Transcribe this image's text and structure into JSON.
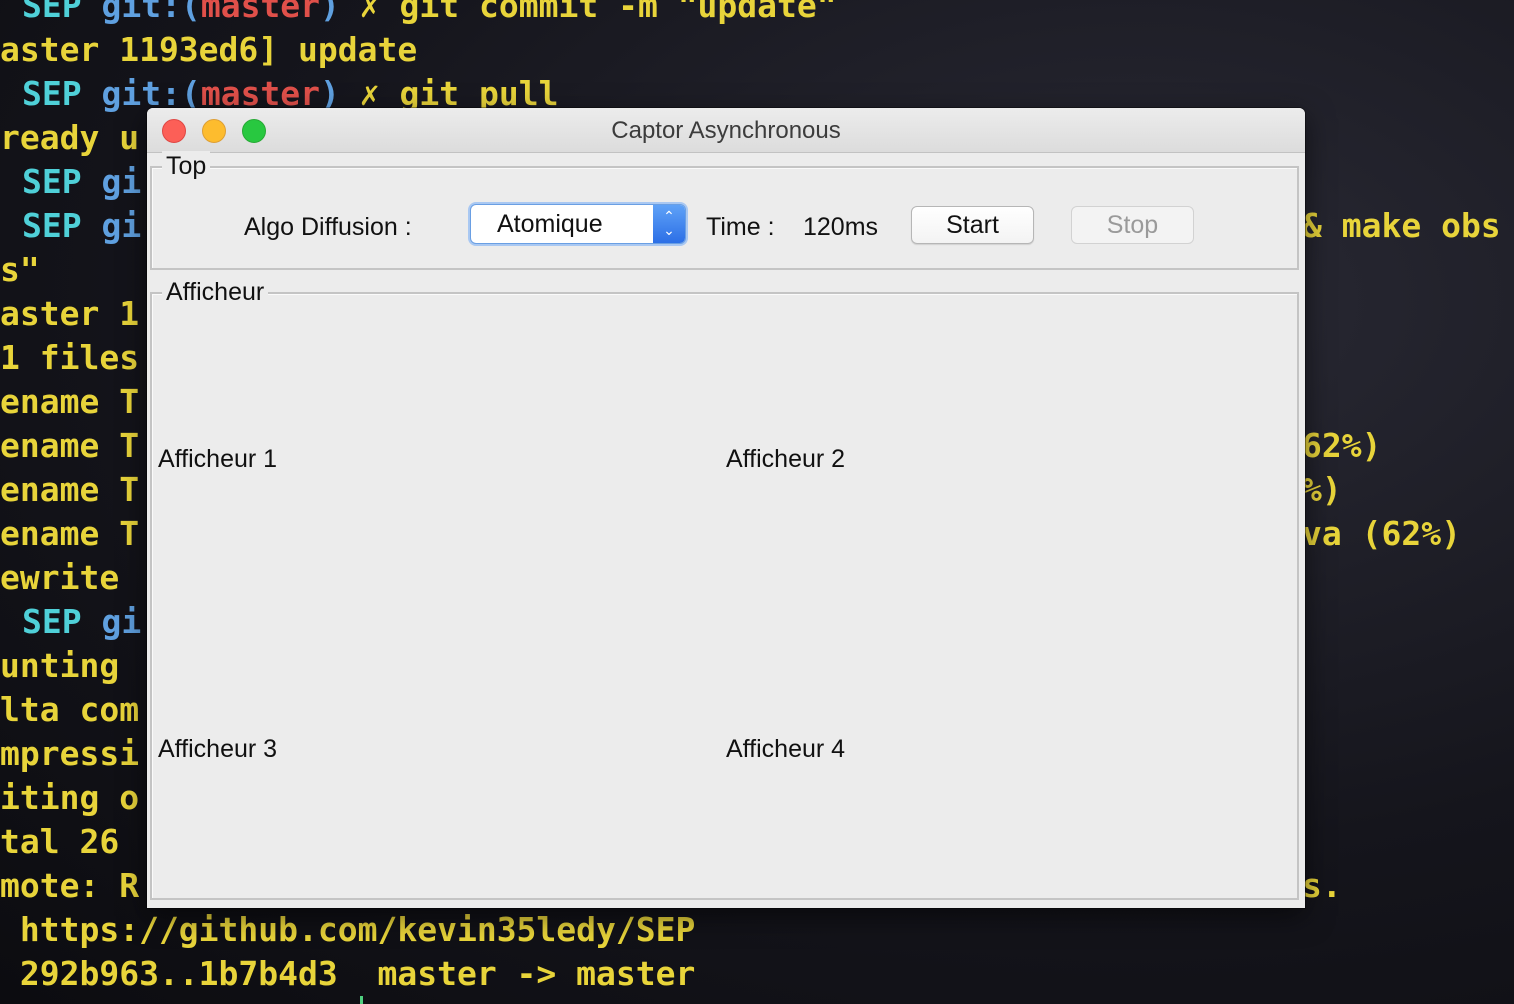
{
  "terminal": {
    "lines": [
      {
        "prompt": "SEP",
        "git": "git:(",
        "branch": "master",
        "close": ")",
        "mark": "✗",
        "cmd": "git commit -m \"update\""
      },
      {
        "text": "aster 1193ed6] update"
      },
      {
        "prompt": "SEP",
        "git": "git:(",
        "branch": "master",
        "close": ")",
        "mark": "✗",
        "cmd": "git pull"
      },
      {
        "text": "ready u"
      },
      {
        "prompt": "SEP",
        "git": "gi"
      },
      {
        "prompt": "SEP",
        "git": "gi"
      },
      {
        "text": "s\""
      },
      {
        "text": "aster 1"
      },
      {
        "text": "1 files"
      },
      {
        "text": "ename T"
      },
      {
        "text": "ename T"
      },
      {
        "text": "ename T"
      },
      {
        "text": "ename T"
      },
      {
        "text": "ewrite"
      },
      {
        "prompt": "SEP",
        "git": "gi"
      },
      {
        "text": "unting"
      },
      {
        "text": "lta com"
      },
      {
        "text": "mpressi"
      },
      {
        "text": "iting o"
      },
      {
        "text": "tal 26"
      },
      {
        "text": "mote: R"
      },
      {
        "text": " https://github.com/kevin35ledy/SEP"
      },
      {
        "text": " 292b963..1b7b4d3  master -> master"
      }
    ],
    "right_fragments": [
      {
        "text": "& make obs"
      },
      {
        "text": "62%)"
      },
      {
        "text": "%)"
      },
      {
        "text": "va (62%)"
      },
      {
        "text": "s."
      }
    ]
  },
  "window": {
    "title": "Captor Asynchronous",
    "top_group": {
      "title": "Top",
      "algo_label": "Algo Diffusion :",
      "algo_selected": "Atomique",
      "time_label": "Time :",
      "time_value": "120ms",
      "start_label": "Start",
      "stop_label": "Stop"
    },
    "display_group": {
      "title": "Afficheur",
      "displays": [
        "Afficheur 1",
        "Afficheur 2",
        "Afficheur 3",
        "Afficheur 4"
      ]
    }
  },
  "colors": {
    "terminal_yellow": "#e8d43a",
    "terminal_cyan": "#4fd0d8",
    "terminal_red": "#e0504a",
    "window_bg": "#ececec",
    "select_accent": "#2c6fe6"
  }
}
